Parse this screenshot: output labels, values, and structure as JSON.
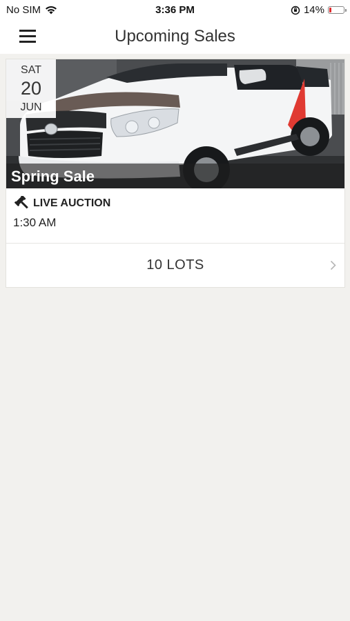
{
  "status_bar": {
    "carrier": "No SIM",
    "time": "3:36 PM",
    "battery_percent": "14%",
    "battery_level": 0.14,
    "battery_color": "#e0292b"
  },
  "nav": {
    "title": "Upcoming Sales",
    "menu_icon": "hamburger-menu-icon"
  },
  "sales": [
    {
      "date": {
        "weekday": "SAT",
        "day": "20",
        "month": "JUN"
      },
      "name": "Spring Sale",
      "type_icon": "gavel-icon",
      "type_label": "LIVE AUCTION",
      "time": "1:30 AM",
      "lots_label": "10 LOTS",
      "image": "white pickup truck"
    }
  ],
  "colors": {
    "background": "#f2f1ee",
    "card": "#ffffff",
    "text": "#222222"
  }
}
